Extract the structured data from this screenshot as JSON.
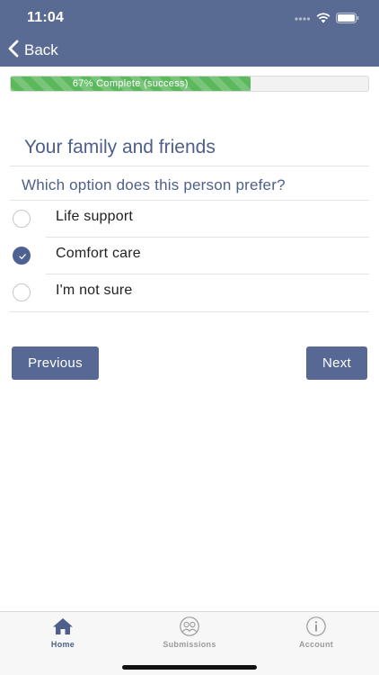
{
  "status": {
    "time": "11:04"
  },
  "nav": {
    "back_label": "Back"
  },
  "progress": {
    "percent": 67,
    "label": "67% Complete (success)"
  },
  "survey": {
    "section_title": "Your family and friends",
    "question": "Which option does this person prefer?",
    "options": [
      {
        "label": "Life support",
        "selected": false
      },
      {
        "label": "Comfort care",
        "selected": true
      },
      {
        "label": "I'm not sure",
        "selected": false
      }
    ]
  },
  "buttons": {
    "previous_label": "Previous",
    "next_label": "Next"
  },
  "tabs": [
    {
      "label": "Home",
      "icon": "home-icon",
      "active": true
    },
    {
      "label": "Submissions",
      "icon": "people-icon",
      "active": false
    },
    {
      "label": "Account",
      "icon": "info-icon",
      "active": false
    }
  ],
  "colors": {
    "header": "#5a6b93",
    "accent": "#4e6193",
    "progress": "#5cb85c"
  }
}
